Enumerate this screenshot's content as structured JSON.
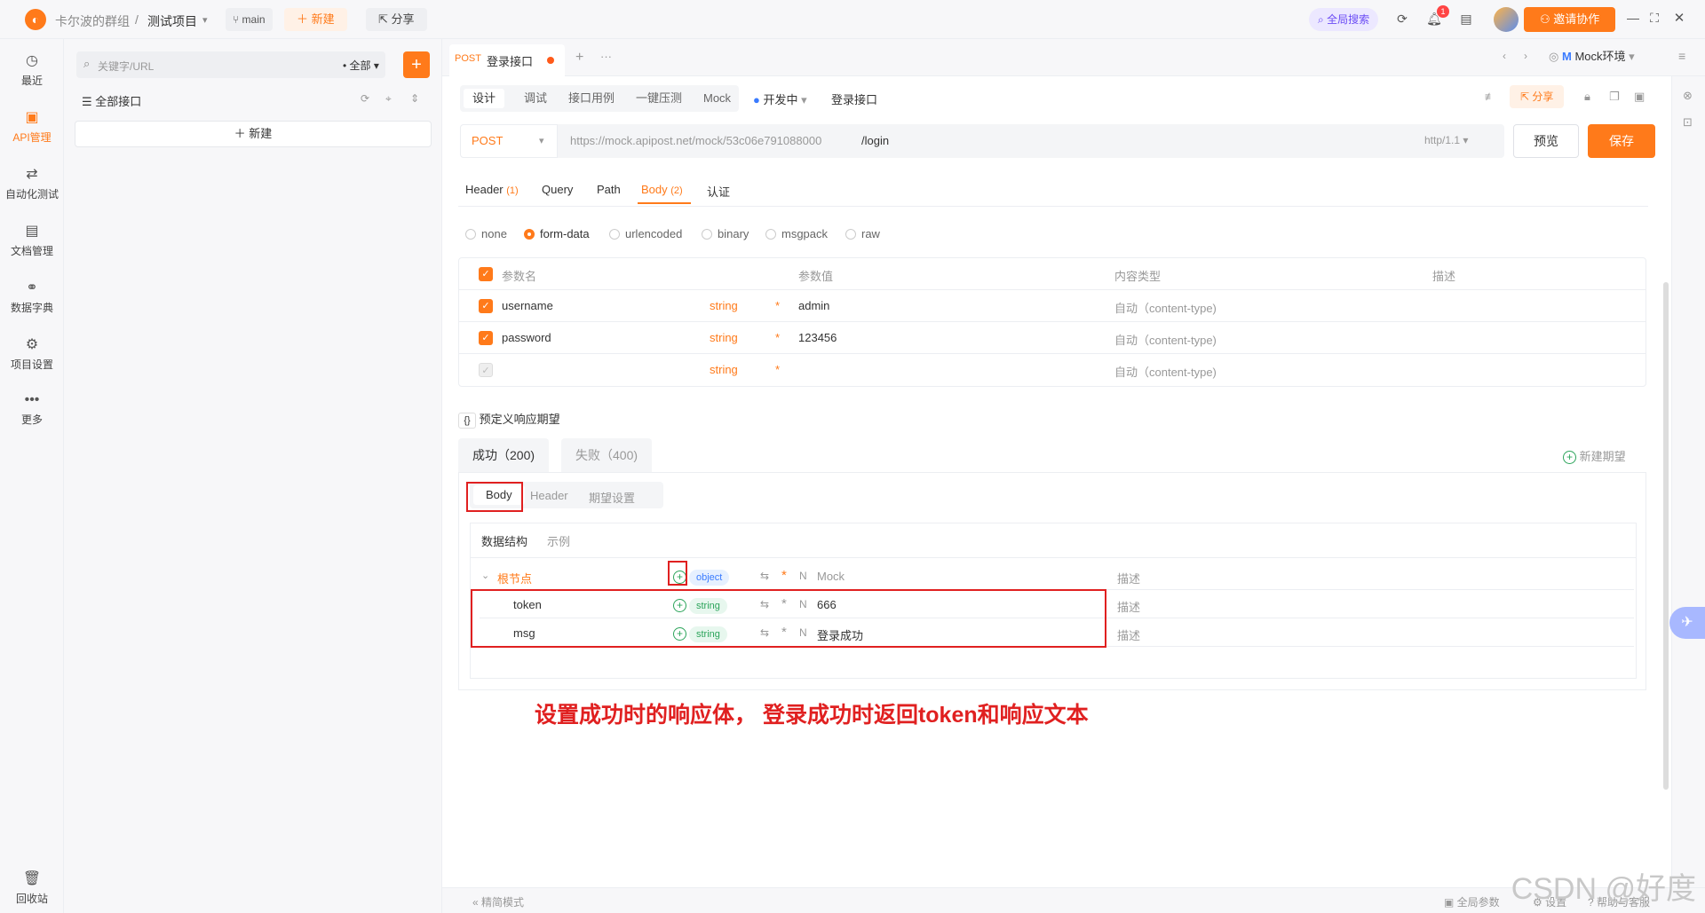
{
  "topbar": {
    "team": "卡尔波的群组",
    "sep": "/",
    "project": "测试项目",
    "branch": "main",
    "new_btn": "新建",
    "share_btn": "分享",
    "global_search": "全局搜索",
    "notif_count": "1",
    "invite_btn": "邀请协作"
  },
  "rail": [
    {
      "label": "最近",
      "icon": "clock-icon",
      "glyph": "◷"
    },
    {
      "label": "API管理",
      "icon": "api-icon",
      "glyph": "▣"
    },
    {
      "label": "自动化测试",
      "icon": "flow-icon",
      "glyph": "⇄"
    },
    {
      "label": "文档管理",
      "icon": "doc-icon",
      "glyph": "▤"
    },
    {
      "label": "数据字典",
      "icon": "dict-icon",
      "glyph": "⚭"
    },
    {
      "label": "项目设置",
      "icon": "settings-icon",
      "glyph": "⚙"
    },
    {
      "label": "更多",
      "icon": "more-icon",
      "glyph": "•••"
    }
  ],
  "rail_bottom": {
    "label": "回收站",
    "glyph": "🗑"
  },
  "tree": {
    "search_placeholder": "关键字/URL",
    "filter": "全部",
    "root_label": "全部接口",
    "new_label": "新建"
  },
  "tabs": {
    "method": "POST",
    "title": "登录接口",
    "env": "Mock环境",
    "env_prefix": "M"
  },
  "mode_tabs": [
    "设计",
    "调试",
    "接口用例",
    "一键压测",
    "Mock"
  ],
  "status": "开发中",
  "api_name": "登录接口",
  "share_label": "分享",
  "url": {
    "method": "POST",
    "prefix": "https://mock.apipost.net/mock/53c06e791088000",
    "path": "/login",
    "version": "http/1.1",
    "preview": "预览",
    "save": "保存"
  },
  "param_tabs": [
    {
      "label": "Header",
      "count": "(1)"
    },
    {
      "label": "Query",
      "count": ""
    },
    {
      "label": "Path",
      "count": ""
    },
    {
      "label": "Body",
      "count": "(2)"
    },
    {
      "label": "认证",
      "count": ""
    }
  ],
  "body_types": [
    "none",
    "form-data",
    "urlencoded",
    "binary",
    "msgpack",
    "raw"
  ],
  "table": {
    "headers": [
      "参数名",
      "参数值",
      "内容类型",
      "描述"
    ],
    "rows": [
      {
        "name": "username",
        "type": "string",
        "value": "admin",
        "ctype": "自动（content-type)"
      },
      {
        "name": "password",
        "type": "string",
        "value": "123456",
        "ctype": "自动（content-type)"
      },
      {
        "name": "",
        "type": "string",
        "value": "",
        "ctype": "自动（content-type)"
      }
    ]
  },
  "expect": {
    "title": "预定义响应期望",
    "success_tab": "成功（200)",
    "fail_tab": "失败（400)",
    "new_expect": "新建期望",
    "sub_tabs": [
      "Body",
      "Header",
      "期望设置"
    ],
    "struct_tabs": [
      "数据结构",
      "示例"
    ],
    "root": {
      "name": "根节点",
      "type": "object",
      "mock": "Mock",
      "desc": "描述"
    },
    "fields": [
      {
        "name": "token",
        "type": "string",
        "value": "666",
        "desc": "描述"
      },
      {
        "name": "msg",
        "type": "string",
        "value": "登录成功",
        "desc": "描述"
      }
    ]
  },
  "annotation": "设置成功时的响应体， 登录成功时返回token和响应文本",
  "footer": {
    "simple_mode": "精简模式",
    "global_params": "全局参数",
    "settings": "设置",
    "help": "帮助与客服"
  },
  "watermark": "CSDN @好度"
}
